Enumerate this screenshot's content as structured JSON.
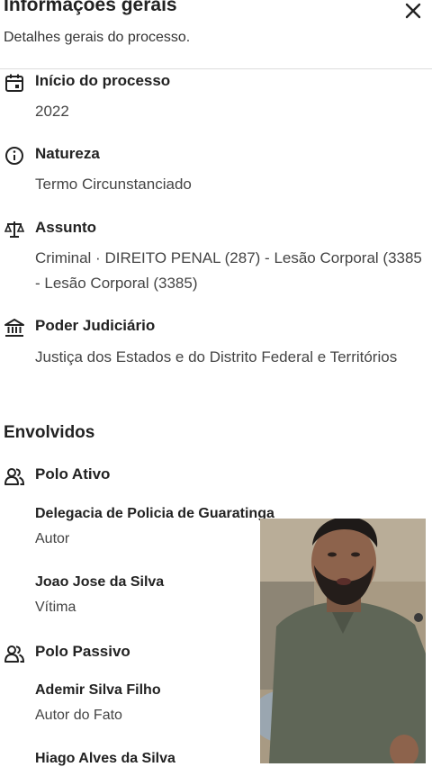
{
  "header": {
    "title": "Informações gerais",
    "subtitle": "Detalhes gerais do processo.",
    "close_icon": "close-icon"
  },
  "details": [
    {
      "icon": "calendar-icon",
      "label": "Início do processo",
      "value": "2022"
    },
    {
      "icon": "info-icon",
      "label": "Natureza",
      "value": "Termo Circunstanciado"
    },
    {
      "icon": "scales-icon",
      "label": "Assunto",
      "value": "Criminal · DIREITO PENAL (287) - Lesão Corporal (3385 - Lesão Corporal (3385)"
    },
    {
      "icon": "courthouse-icon",
      "label": "Poder Judiciário",
      "value": "Justiça dos Estados e do Distrito Federal e Territórios"
    }
  ],
  "involved": {
    "title": "Envolvidos",
    "polo_ativo": {
      "label": "Polo Ativo",
      "people": [
        {
          "name": "Delegacia de Policia de Guaratinga",
          "role": "Autor"
        },
        {
          "name": "Joao Jose da Silva",
          "role": "Vítima"
        }
      ]
    },
    "polo_passivo": {
      "label": "Polo Passivo",
      "people": [
        {
          "name": "Ademir Silva Filho",
          "role": "Autor do Fato"
        },
        {
          "name": "Hiago Alves da Silva",
          "role": ""
        }
      ]
    }
  },
  "overlay": {
    "description_icon": "video-overlay"
  }
}
